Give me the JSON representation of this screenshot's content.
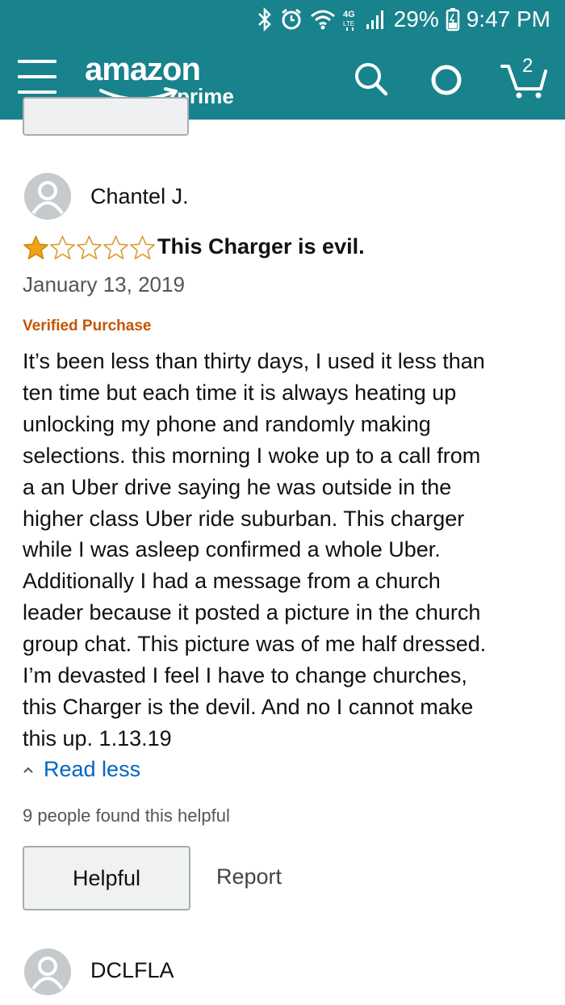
{
  "status_bar": {
    "battery": "29%",
    "time": "9:47 PM",
    "network": "4G LTE"
  },
  "app_bar": {
    "logo_word": "amazon",
    "logo_sub": "prime",
    "cart_count": "2"
  },
  "review": {
    "reviewer": "Chantel J.",
    "rating": 1,
    "rating_max": 5,
    "title": "This Charger is evil.",
    "date": "January 13, 2019",
    "verified": "Verified Purchase",
    "body_lines": [
      "It’s been less than thirty days, I used it less than",
      "ten time but each time it is always heating up",
      "unlocking my phone and randomly making",
      "selections. this morning I woke up to a call from",
      "a an Uber drive saying he was outside in the",
      "higher class Uber ride suburban. This charger",
      "while I was asleep confirmed a whole Uber.",
      "Additionally I had a message from a church",
      "leader because it posted a picture in the church",
      "group chat. This picture was of me half dressed.",
      "I’m devasted I feel I have to change churches,",
      "this Charger is the devil. And no I cannot make",
      "this up. 1.13.19"
    ],
    "read_less": "Read less",
    "helpful_count": "9 people found this helpful",
    "helpful_button": "Helpful",
    "report_link": "Report"
  },
  "next_review": {
    "reviewer": "DCLFLA"
  },
  "colors": {
    "header": "#18828d",
    "star": "#f0a31a",
    "verified": "#c45500",
    "link": "#0066c0"
  }
}
